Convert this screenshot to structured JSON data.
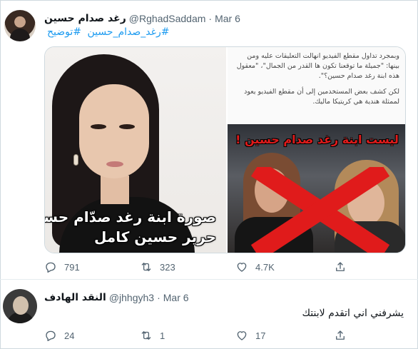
{
  "tweet": {
    "display_name": "رغد صدام حسين",
    "handle": "@RghadSaddam",
    "separator": "·",
    "date": "Mar 6",
    "hashtags": [
      "#رغد_صدام_حسين",
      "#توضيح"
    ],
    "media": {
      "left_overlay_line1": "صورة ابنة رغد صدّام حسين",
      "left_overlay_line2": "حرير حسين كامل",
      "article_para1": "وبمجرد تداول مقطع الفيديو انهالت التعليقات عليه ومن بينها: \"جميلة ما توقعنا تكون ها القدر من الجمال\"، \"معقول هذه ابنة رغد صدام حسين؟\".",
      "article_para2": "لكن كشف بعض المستخدمين إلى أن مقطع الفيديو يعود لممثلة هندية هي كريتيكا ماليك.",
      "right_caption": "ليست ابنة رغد صدام حسين !"
    },
    "actions": {
      "replies": "791",
      "retweets": "323",
      "likes": "4.7K"
    }
  },
  "reply": {
    "display_name": "النقد الهادف",
    "handle": "@jhhgyh3",
    "separator": "·",
    "date": "Mar 6",
    "text": "يشرفني اني اتقدم لابنتك",
    "actions": {
      "replies": "24",
      "retweets": "1",
      "likes": "17"
    }
  },
  "colors": {
    "link": "#1d9bf0",
    "muted": "#536471",
    "text": "#0f1419",
    "red_mark": "#e01b1b"
  },
  "icons": [
    "reply-icon",
    "retweet-icon",
    "like-icon",
    "share-icon"
  ]
}
